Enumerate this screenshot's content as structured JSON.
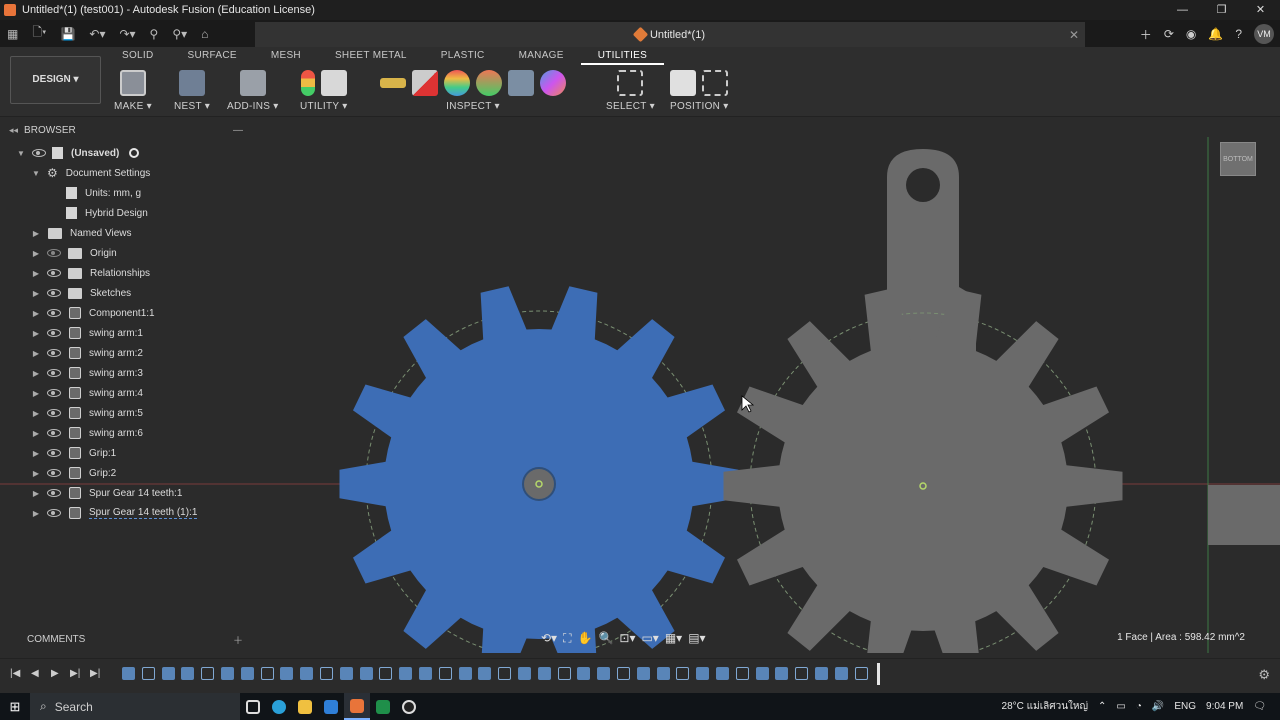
{
  "window": {
    "title": "Untitled*(1) (test001) - Autodesk Fusion (Education License)"
  },
  "document_tab": {
    "title": "Untitled*(1)"
  },
  "user": {
    "initials": "VM"
  },
  "ribbon": {
    "tabs": [
      "SOLID",
      "SURFACE",
      "MESH",
      "SHEET METAL",
      "PLASTIC",
      "MANAGE",
      "UTILITIES"
    ],
    "active_tab": "UTILITIES",
    "workspace": "DESIGN",
    "groups": [
      "MAKE",
      "NEST",
      "ADD-INS",
      "UTILITY",
      "INSPECT",
      "SELECT",
      "POSITION"
    ]
  },
  "browser": {
    "title": "BROWSER",
    "root": "(Unsaved)",
    "items": [
      {
        "label": "Document Settings"
      },
      {
        "label": "Units: mm, g"
      },
      {
        "label": "Hybrid Design"
      },
      {
        "label": "Named Views"
      },
      {
        "label": "Origin"
      },
      {
        "label": "Relationships"
      },
      {
        "label": "Sketches"
      },
      {
        "label": "Component1:1"
      },
      {
        "label": "swing arm:1"
      },
      {
        "label": "swing arm:2"
      },
      {
        "label": "swing arm:3"
      },
      {
        "label": "swing arm:4"
      },
      {
        "label": "swing arm:5"
      },
      {
        "label": "swing arm:6"
      },
      {
        "label": "Grip:1"
      },
      {
        "label": "Grip:2"
      },
      {
        "label": "Spur Gear 14 teeth:1"
      },
      {
        "label": "Spur Gear 14 teeth (1):1"
      }
    ]
  },
  "comments": {
    "title": "COMMENTS"
  },
  "viewcube": {
    "face": "BOTTOM"
  },
  "status": {
    "selection": "1 Face | Area : 598.42 mm^2"
  },
  "colors": {
    "selected_gear": "#3d6db5",
    "other_gear": "#6a6a6a",
    "accent": "#e07b39"
  },
  "taskbar": {
    "search_placeholder": "Search",
    "weather": "28°C แม่เลิศวนใหญ่",
    "language": "ENG",
    "time": "9:04 PM"
  }
}
